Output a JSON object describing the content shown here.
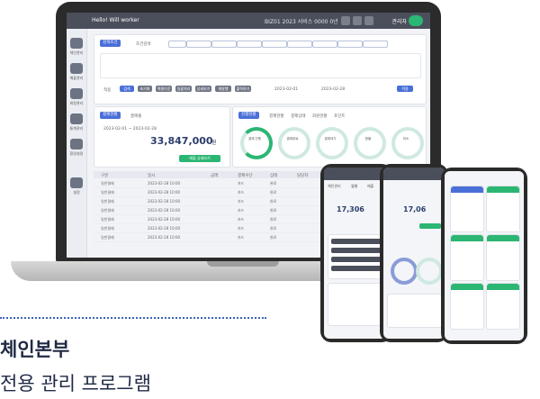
{
  "app": {
    "window_title": "Hello! Will worker",
    "header_info": "BIZ01 2023 서비스 0000 0년",
    "user_label": "관리자"
  },
  "sidebar": {
    "items": [
      {
        "label": "체인관리"
      },
      {
        "label": "매출관리"
      },
      {
        "label": "회원관리"
      },
      {
        "label": "통계관리"
      },
      {
        "label": "환경설정"
      },
      {
        "label": "설정"
      }
    ]
  },
  "search_panel": {
    "tab_label": "검색조건",
    "filter_label": "조건검색",
    "date_from": "2023-02-01",
    "date_to": "2023-02-28",
    "apply_button": "적용",
    "action_buttons": [
      "검색",
      "초기화",
      "엑셀다운",
      "일괄처리",
      "상세보기",
      "재발행",
      "출력하기"
    ]
  },
  "summary_panel": {
    "tab_label": "결제현황",
    "sub_label": "총매출",
    "date_range": "2023-02-01 ~ 2023-02-28",
    "amount": "33,847,000",
    "currency": "원",
    "green_button": "매출 상세보기"
  },
  "chart_panel": {
    "tab_label": "진행현황",
    "tabs": [
      "결제현황",
      "결제상태",
      "회원현황",
      "포인트"
    ],
    "rings": [
      "결제 진행",
      "결제완료",
      "결제대기",
      "환불",
      "취소"
    ]
  },
  "table": {
    "headers": [
      "구분",
      "일시",
      "금액",
      "결제수단",
      "상태",
      "담당자"
    ],
    "rows": [
      [
        "일반결제",
        "2023-02-28 10:00",
        "카드",
        "완료"
      ],
      [
        "일반결제",
        "2023-02-28 10:00",
        "카드",
        "완료"
      ],
      [
        "일반결제",
        "2023-02-28 10:00",
        "카드",
        "완료"
      ],
      [
        "일반결제",
        "2023-02-28 10:00",
        "카드",
        "완료"
      ],
      [
        "일반결제",
        "2023-02-28 10:00",
        "카드",
        "완료"
      ],
      [
        "일반결제",
        "2023-02-28 10:00",
        "카드",
        "완료"
      ],
      [
        "일반결제",
        "2023-02-28 10:00",
        "카드",
        "완료"
      ]
    ]
  },
  "phone1": {
    "tabs": [
      "체인관리",
      "월별",
      "매출"
    ],
    "amount": "17,306"
  },
  "phone2": {
    "amount": "17,06"
  },
  "caption": {
    "title": "체인본부",
    "subtitle": "전용 관리 프로그램"
  },
  "colors": {
    "accent_blue": "#4a6fd8",
    "accent_green": "#2bb673",
    "dark_header": "#4b4f5c"
  }
}
